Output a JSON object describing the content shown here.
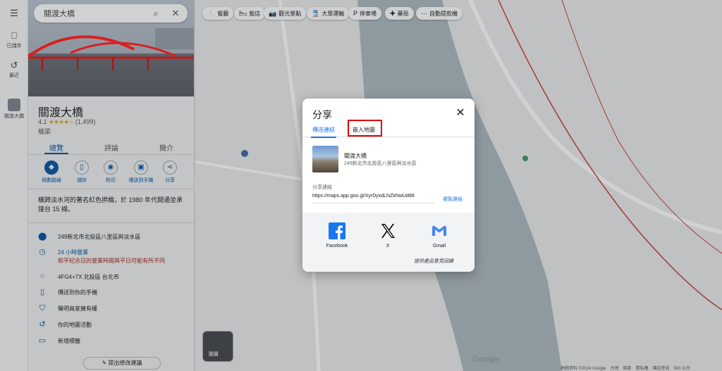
{
  "search": {
    "value": "關渡大橋"
  },
  "rail": {
    "saved": "已儲存",
    "recents": "最近",
    "recent_place": "關渡大橋"
  },
  "place": {
    "title": "關渡大橋",
    "rating_value": "4.1",
    "stars": "★★★★☆",
    "review_count": "(1,499)",
    "type": "橋梁",
    "tabs": [
      "總覽",
      "評論",
      "簡介"
    ],
    "actions": [
      "規劃路線",
      "儲存",
      "附近",
      "傳送到手機",
      "分享"
    ],
    "description": "橫跨淡水河的著名紅色拱橋，於 1980 年代開通並承接台 15 線。",
    "info": {
      "address": "249新北市北投區八里區與淡水區",
      "hours": "24 小時營業",
      "hours_note": "和平紀念日的營業時間與平日可能有所不同",
      "plus_code": "4FG4+7X 北投區 台北市",
      "send_to_phone": "傳送到你的手機",
      "claim": "聲明商家擁有權",
      "activity": "你的地圖活動",
      "add_label": "新增標籤"
    },
    "suggest_edit": "提出修改建議"
  },
  "chips": [
    "餐廳",
    "飯店",
    "觀光景點",
    "大眾運輸",
    "停車場",
    "藥局",
    "自動提款機"
  ],
  "map": {
    "thumb_label": "圖層",
    "google_logo": "Google",
    "footer": "地圖資料 ©2024 Google　台灣　條款　隱私權　傳送意見　500 公尺"
  },
  "dialog": {
    "title": "分享",
    "tabs": {
      "send_link": "傳送連結",
      "embed_map": "嵌入地圖"
    },
    "place_name": "關渡大橋",
    "place_address": "249新北市北投區八里區與淡水區",
    "link_label": "分享連結",
    "link_value": "https://maps.app.goo.gl/XyrDyxdLNZkNwUd88",
    "copy_link": "複製連結",
    "social": [
      "Facebook",
      "X",
      "Gmail"
    ],
    "feedback": "提供產品意見回饋"
  },
  "colors": {
    "highlight": "#e00000",
    "link_blue": "#1a73e8",
    "facebook": "#1877f2"
  }
}
